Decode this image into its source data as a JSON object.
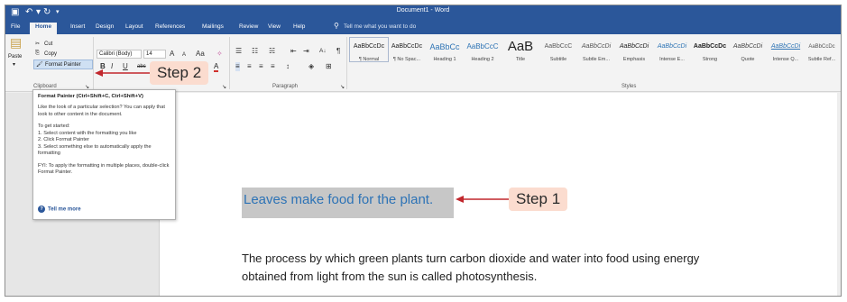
{
  "window": {
    "title": "Document1 - Word",
    "colors": {
      "title_bar": "#2b579a",
      "highlight": "#c7c7c7",
      "selected_text": "#2d73b6",
      "callout_fill": "#fbdccf",
      "arrow": "#c1272d"
    }
  },
  "quick_access": [
    "save-icon",
    "undo-icon",
    "redo-icon",
    "customize-icon"
  ],
  "ribbon_tabs": [
    "File",
    "Home",
    "Insert",
    "Design",
    "Layout",
    "References",
    "Mailings",
    "Review",
    "View",
    "Help"
  ],
  "active_tab": "Home",
  "tell_me": "Tell me what you want to do",
  "clipboard": {
    "paste": "Paste",
    "cut": "Cut",
    "copy": "Copy",
    "format_painter": "Format Painter",
    "label": "Clipboard"
  },
  "font": {
    "name": "Calibri (Body)",
    "size": "14",
    "grow": "A",
    "shrink": "A",
    "case": "Aa",
    "bold": "B",
    "italic": "I",
    "underline": "U",
    "strike": "abc",
    "font_color": "A"
  },
  "paragraph": {
    "label": "Paragraph",
    "sort": "A↓",
    "pilcrow": "¶"
  },
  "styles": {
    "label": "Styles",
    "items": [
      {
        "preview": "AaBbCcDc",
        "name": "¶ Normal"
      },
      {
        "preview": "AaBbCcDc",
        "name": "¶ No Spac..."
      },
      {
        "preview": "AaBbCc",
        "name": "Heading 1"
      },
      {
        "preview": "AaBbCcC",
        "name": "Heading 2"
      },
      {
        "preview": "AaB",
        "name": "Title"
      },
      {
        "preview": "AaBbCcC",
        "name": "Subtitle"
      },
      {
        "preview": "AaBbCcDi",
        "name": "Subtle Em..."
      },
      {
        "preview": "AaBbCcDi",
        "name": "Emphasis"
      },
      {
        "preview": "AaBbCcDi",
        "name": "Intense E..."
      },
      {
        "preview": "AaBbCcDc",
        "name": "Strong"
      },
      {
        "preview": "AaBbCcDi",
        "name": "Quote"
      },
      {
        "preview": "AaBbCcDi",
        "name": "Intense Q..."
      },
      {
        "preview": "AaBbCcDc",
        "name": "Subtle Ref..."
      }
    ]
  },
  "tooltip": {
    "title": "Format Painter (Ctrl+Shift+C, Ctrl+Shift+V)",
    "desc": "Like the look of a particular selection? You can apply that look to other content in the document.",
    "start": "To get started:",
    "step1": "1. Select content with the formatting you like",
    "step2": "2. Click Format Painter",
    "step3": "3. Select something else to automatically apply the formatting",
    "fyi": "FYI: To apply the formatting in multiple places, double-click Format Painter.",
    "link": "Tell me more"
  },
  "document": {
    "selected": "Leaves make food for the plant.",
    "body_line1": "The process by which green plants turn carbon dioxide and water into food using energy",
    "body_line2": "obtained from light from the sun is called photosynthesis."
  },
  "callouts": {
    "step1": "Step 1",
    "step2": "Step 2"
  }
}
